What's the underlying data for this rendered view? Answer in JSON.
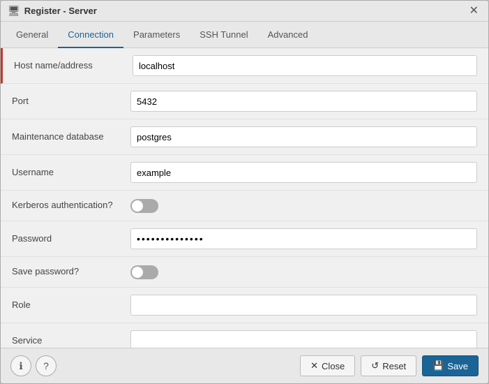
{
  "dialog": {
    "title": "Register - Server",
    "title_icon": "🖥"
  },
  "tabs": [
    {
      "id": "general",
      "label": "General",
      "active": false
    },
    {
      "id": "connection",
      "label": "Connection",
      "active": true
    },
    {
      "id": "parameters",
      "label": "Parameters",
      "active": false
    },
    {
      "id": "ssh_tunnel",
      "label": "SSH Tunnel",
      "active": false
    },
    {
      "id": "advanced",
      "label": "Advanced",
      "active": false
    }
  ],
  "fields": [
    {
      "id": "host",
      "label": "Host name/address",
      "type": "text",
      "value": "localhost",
      "highlighted": true
    },
    {
      "id": "port",
      "label": "Port",
      "type": "text",
      "value": "5432",
      "highlighted": false
    },
    {
      "id": "maintenance_db",
      "label": "Maintenance database",
      "type": "text",
      "value": "postgres",
      "highlighted": false
    },
    {
      "id": "username",
      "label": "Username",
      "type": "text",
      "value": "example",
      "highlighted": false
    },
    {
      "id": "kerberos",
      "label": "Kerberos authentication?",
      "type": "toggle",
      "value": false,
      "highlighted": false
    },
    {
      "id": "password",
      "label": "Password",
      "type": "password",
      "value": "••••••••••••••",
      "highlighted": false
    },
    {
      "id": "save_password",
      "label": "Save password?",
      "type": "toggle",
      "value": false,
      "highlighted": false
    },
    {
      "id": "role",
      "label": "Role",
      "type": "text",
      "value": "",
      "highlighted": false
    },
    {
      "id": "service",
      "label": "Service",
      "type": "text",
      "value": "",
      "highlighted": false
    }
  ],
  "footer": {
    "info_icon": "ℹ",
    "help_icon": "?",
    "close_label": "Close",
    "reset_label": "Reset",
    "save_label": "Save",
    "close_icon": "✕",
    "reset_icon": "↺"
  }
}
